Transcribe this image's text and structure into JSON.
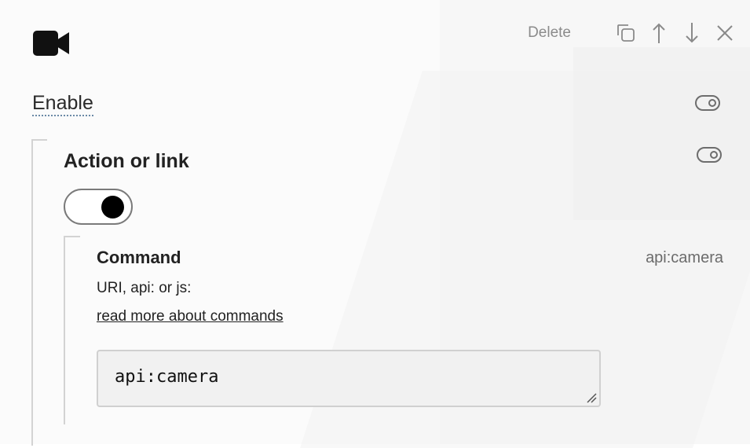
{
  "header": {
    "delete_label": "Delete",
    "icons": [
      "camera-icon",
      "duplicate-icon",
      "move-up-icon",
      "move-down-icon",
      "close-icon"
    ]
  },
  "enable": {
    "label": "Enable",
    "toggle_state": "off"
  },
  "action_or_link": {
    "title": "Action or link",
    "toggle_state": "on",
    "command": {
      "title": "Command",
      "current_value": "api:camera",
      "hint": "URI, api: or js:",
      "help_link": "read more about commands",
      "input_value": "api:camera"
    }
  },
  "colors": {
    "accent_dark": "#000000",
    "muted_text": "#8b8b8b",
    "input_bg": "#f1f1f1"
  }
}
